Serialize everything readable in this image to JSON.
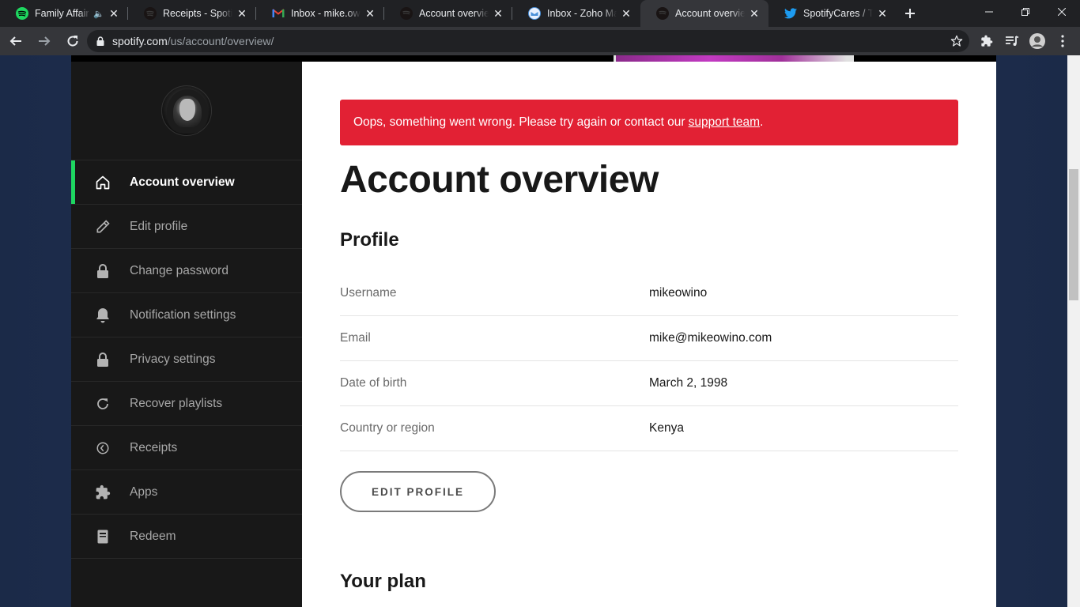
{
  "browser": {
    "tabs": [
      {
        "title": "Family Affair -",
        "icon": "spotify-icon",
        "audio": true
      },
      {
        "title": "Receipts - Spotify",
        "icon": "spotify-dark-icon"
      },
      {
        "title": "Inbox - mike.owino",
        "icon": "gmail-icon"
      },
      {
        "title": "Account overview",
        "icon": "spotify-dark-icon"
      },
      {
        "title": "Inbox - Zoho Mail",
        "icon": "zoho-mail-icon"
      },
      {
        "title": "Account overview",
        "icon": "spotify-dark-icon",
        "active": true
      },
      {
        "title": "SpotifyCares / Twitt",
        "icon": "twitter-icon"
      }
    ],
    "url_host": "spotify.com",
    "url_path": "/us/account/overview/"
  },
  "sidebar": {
    "items": [
      {
        "label": "Account overview",
        "icon": "home-icon",
        "active": true
      },
      {
        "label": "Edit profile",
        "icon": "pencil-icon"
      },
      {
        "label": "Change password",
        "icon": "lock-icon"
      },
      {
        "label": "Notification settings",
        "icon": "bell-icon"
      },
      {
        "label": "Privacy settings",
        "icon": "lock-icon"
      },
      {
        "label": "Recover playlists",
        "icon": "refresh-icon"
      },
      {
        "label": "Receipts",
        "icon": "clock-icon"
      },
      {
        "label": "Apps",
        "icon": "puzzle-icon"
      },
      {
        "label": "Redeem",
        "icon": "card-icon"
      }
    ]
  },
  "alert": {
    "text": "Oops, something went wrong. Please try again or contact our",
    "link": "support team",
    "suffix": "."
  },
  "main": {
    "title": "Account overview",
    "profile_heading": "Profile",
    "profile": [
      {
        "label": "Username",
        "value": "mikeowino"
      },
      {
        "label": "Email",
        "value": "mike@mikeowino.com"
      },
      {
        "label": "Date of birth",
        "value": "March 2, 1998"
      },
      {
        "label": "Country or region",
        "value": "Kenya"
      }
    ],
    "edit_button": "EDIT PROFILE",
    "plan_heading": "Your plan"
  },
  "colors": {
    "accent": "#1ed760",
    "alert": "#e22134",
    "sidebar_bg": "#181818"
  }
}
